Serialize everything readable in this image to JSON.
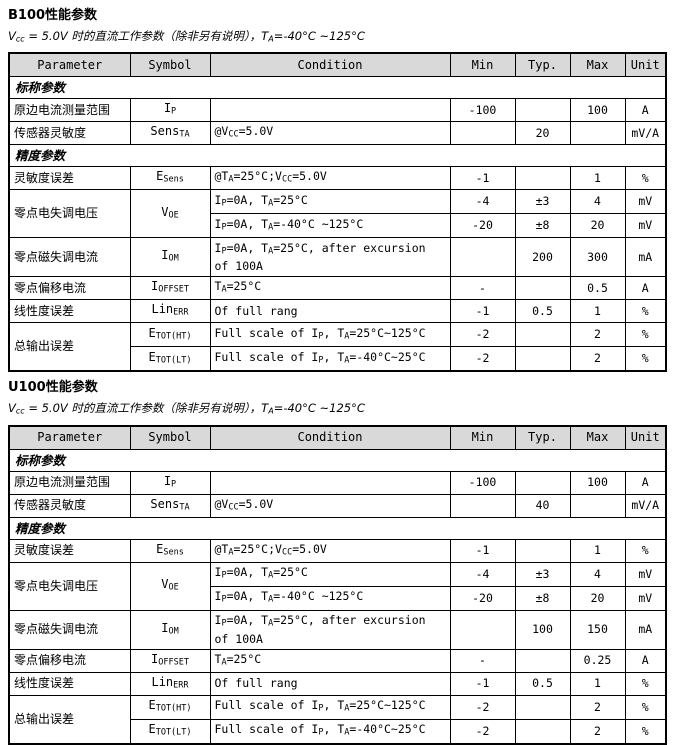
{
  "document": {
    "columns": [
      "Parameter",
      "Symbol",
      "Condition",
      "Min",
      "Typ.",
      "Max",
      "Unit"
    ],
    "header_bg": "#d9d9d9"
  },
  "sections": [
    {
      "title": "B100性能参数",
      "subtitle_html": "V<sub>cc</sub> = 5.0V 时的直流工作参数（除非另有说明），T<sub>A</sub>=-40°C ~125°C",
      "groups": [
        {
          "label": "标称参数",
          "rows": [
            {
              "param": "原边电流测量范围",
              "symbol_html": "I<sub>P</sub>",
              "condition_html": "",
              "min": "-100",
              "typ": "",
              "max": "100",
              "unit": "A"
            },
            {
              "param": "传感器灵敏度",
              "symbol_html": "Sens<sub>TA</sub>",
              "condition_html": "@V<sub>CC</sub>=5.0V",
              "min": "",
              "typ": "20",
              "max": "",
              "unit": "mV/A"
            }
          ]
        },
        {
          "label": "精度参数",
          "rows": [
            {
              "param": "灵敏度误差",
              "symbol_html": "E<sub>Sens</sub>",
              "condition_html": "@T<sub>A</sub>=25°C;V<sub>CC</sub>=5.0V",
              "min": "-1",
              "typ": "",
              "max": "1",
              "unit": "%"
            },
            {
              "param": "零点电失调电压",
              "symbol_html": "V<sub>OE</sub>",
              "rowspan": 2,
              "subrows": [
                {
                  "condition_html": "I<sub>P</sub>=0A, T<sub>A</sub>=25°C",
                  "min": "-4",
                  "typ": "±3",
                  "max": "4",
                  "unit": "mV"
                },
                {
                  "condition_html": "I<sub>P</sub>=0A, T<sub>A</sub>=-40°C ~125°C",
                  "min": "-20",
                  "typ": "±8",
                  "max": "20",
                  "unit": "mV"
                }
              ]
            },
            {
              "param": "零点磁失调电流",
              "symbol_html": "I<sub>OM</sub>",
              "condition_html": "I<sub>P</sub>=0A, T<sub>A</sub>=25°C, after excursion of 100A",
              "min": "",
              "typ": "200",
              "max": "300",
              "unit": "mA",
              "tall": true
            },
            {
              "param": "零点偏移电流",
              "symbol_html": "I<sub>OFFSET</sub>",
              "condition_html": "T<sub>A</sub>=25°C",
              "min": "-",
              "typ": "",
              "max": "0.5",
              "unit": "A"
            },
            {
              "param": "线性度误差",
              "symbol_html": "Lin<sub>ERR</sub>",
              "condition_html": "Of full rang",
              "min": "-1",
              "typ": "0.5",
              "max": "1",
              "unit": "%"
            },
            {
              "param": "总输出误差",
              "rowspan": 2,
              "subrows": [
                {
                  "symbol_html": "E<sub>TOT(HT)</sub>",
                  "condition_html": "Full scale of I<sub>P</sub>, T<sub>A</sub>=25°C~125°C",
                  "min": "-2",
                  "typ": "",
                  "max": "2",
                  "unit": "%"
                },
                {
                  "symbol_html": "E<sub>TOT(LT)</sub>",
                  "condition_html": "Full scale of I<sub>P</sub>, T<sub>A</sub>=-40°C~25°C",
                  "min": "-2",
                  "typ": "",
                  "max": "2",
                  "unit": "%"
                }
              ]
            }
          ]
        }
      ]
    },
    {
      "title": "U100性能参数",
      "subtitle_html": "V<sub>cc</sub> = 5.0V 时的直流工作参数（除非另有说明），T<sub>A</sub>=-40°C ~125°C",
      "groups": [
        {
          "label": "标称参数",
          "rows": [
            {
              "param": "原边电流测量范围",
              "symbol_html": "I<sub>P</sub>",
              "condition_html": "",
              "min": "-100",
              "typ": "",
              "max": "100",
              "unit": "A"
            },
            {
              "param": "传感器灵敏度",
              "symbol_html": "Sens<sub>TA</sub>",
              "condition_html": "@V<sub>CC</sub>=5.0V",
              "min": "",
              "typ": "40",
              "max": "",
              "unit": "mV/A"
            }
          ]
        },
        {
          "label": "精度参数",
          "rows": [
            {
              "param": "灵敏度误差",
              "symbol_html": "E<sub>Sens</sub>",
              "condition_html": "@T<sub>A</sub>=25°C;V<sub>CC</sub>=5.0V",
              "min": "-1",
              "typ": "",
              "max": "1",
              "unit": "%"
            },
            {
              "param": "零点电失调电压",
              "symbol_html": "V<sub>OE</sub>",
              "rowspan": 2,
              "subrows": [
                {
                  "condition_html": "I<sub>P</sub>=0A, T<sub>A</sub>=25°C",
                  "min": "-4",
                  "typ": "±3",
                  "max": "4",
                  "unit": "mV"
                },
                {
                  "condition_html": "I<sub>P</sub>=0A, T<sub>A</sub>=-40°C ~125°C",
                  "min": "-20",
                  "typ": "±8",
                  "max": "20",
                  "unit": "mV"
                }
              ]
            },
            {
              "param": "零点磁失调电流",
              "symbol_html": "I<sub>OM</sub>",
              "condition_html": "I<sub>P</sub>=0A, T<sub>A</sub>=25°C, after excursion of 100A",
              "min": "",
              "typ": "100",
              "max": "150",
              "unit": "mA",
              "tall": true
            },
            {
              "param": "零点偏移电流",
              "symbol_html": "I<sub>OFFSET</sub>",
              "condition_html": "T<sub>A</sub>=25°C",
              "min": "-",
              "typ": "",
              "max": "0.25",
              "unit": "A"
            },
            {
              "param": "线性度误差",
              "symbol_html": "Lin<sub>ERR</sub>",
              "condition_html": "Of full rang",
              "min": "-1",
              "typ": "0.5",
              "max": "1",
              "unit": "%"
            },
            {
              "param": "总输出误差",
              "rowspan": 2,
              "subrows": [
                {
                  "symbol_html": "E<sub>TOT(HT)</sub>",
                  "condition_html": "Full scale of I<sub>P</sub>, T<sub>A</sub>=25°C~125°C",
                  "min": "-2",
                  "typ": "",
                  "max": "2",
                  "unit": "%"
                },
                {
                  "symbol_html": "E<sub>TOT(LT)</sub>",
                  "condition_html": "Full scale of I<sub>P</sub>, T<sub>A</sub>=-40°C~25°C",
                  "min": "-2",
                  "typ": "",
                  "max": "2",
                  "unit": "%"
                }
              ]
            }
          ]
        }
      ]
    }
  ]
}
